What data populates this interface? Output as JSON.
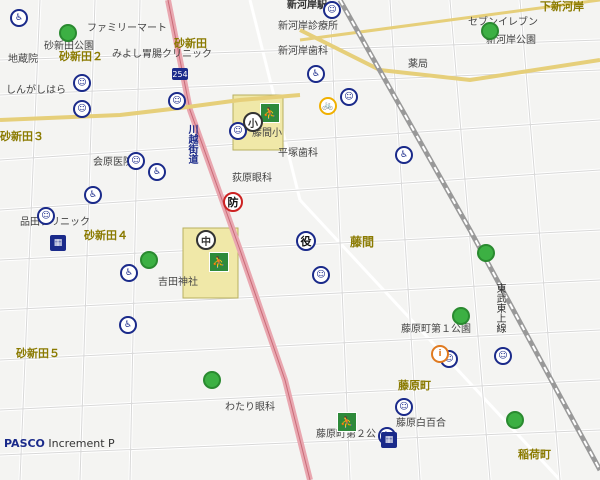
{
  "map": {
    "road_color": "#ffffff",
    "rail_color": "#888888",
    "route254_color": "#e9a7b0",
    "park_color": "#f0e8a8",
    "labels": {
      "station": "新河岸駅",
      "shimo_shingashi": "下新河岸",
      "seven_eleven": "セブンイレブン",
      "shingashi_park": "新河岸公園",
      "shingashi_clinic": "新河岸診療所",
      "shinkawa_dental": "新河岸歯科",
      "pharmacy": "薬局",
      "family_mart": "ファミリーマート",
      "sunashinden_park": "砂新田公園",
      "miyoshi_clinic": "みよし胃腸クリニック",
      "sunashinden": "砂新田",
      "sunashinden2": "砂新田２",
      "kasahara": "しんがしはら",
      "jizodo": "地蔵院",
      "fujima_elem": "藤間小",
      "hiratsuka_dental": "平塚歯科",
      "kaido": "川越街道",
      "ogikubo_eye": "荻原眼科",
      "medical_clinic": "会原医院",
      "sunashinden3": "砂新田３",
      "shinagawa_clinic": "品田クリニック",
      "sunashinden4": "砂新田４",
      "fujima": "藤間",
      "yoshida_shrine": "吉田神社",
      "sunashinden5": "砂新田５",
      "fujiwara1_park": "藤原町第１公園",
      "fujiwara_town": "藤原町",
      "watari_eye": "わたり眼科",
      "fujiwara2_park": "藤原町第２公",
      "fujiwara_shiraiyuri": "藤原白百合",
      "inari": "稲荷町",
      "route_num": "254",
      "city_hall": "役",
      "mid_school": "中",
      "elem_school": "小",
      "fire": "防",
      "higashi_line": "東武東上線",
      "pasco": "PASCO",
      "increment": "Increment P"
    }
  }
}
